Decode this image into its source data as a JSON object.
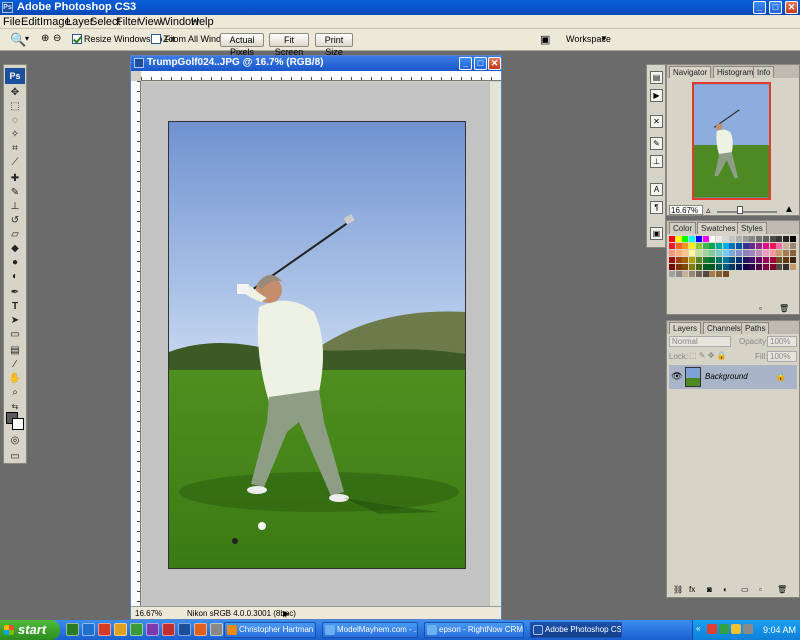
{
  "app": {
    "title": "Adobe Photoshop CS3"
  },
  "menu": [
    "File",
    "Edit",
    "Image",
    "Layer",
    "Select",
    "Filter",
    "View",
    "Window",
    "Help"
  ],
  "options": {
    "resize_windows": "Resize Windows To Fit",
    "zoom_all": "Zoom All Windows",
    "actual_pixels": "Actual Pixels",
    "fit_screen": "Fit Screen",
    "print_size": "Print Size",
    "workspace": "Workspace"
  },
  "document": {
    "title": "TrumpGolf024..JPG @ 16.7% (RGB/8)",
    "zoom": "16.67%",
    "profile": "Nikon sRGB 4.0.0.3001 (8bpc)"
  },
  "navigator": {
    "tabs": [
      "Navigator",
      "Histogram",
      "Info"
    ],
    "zoom": "16.67%"
  },
  "swatches": {
    "tabs": [
      "Color",
      "Swatches",
      "Styles"
    ],
    "colors": [
      "#ff0000",
      "#ffff00",
      "#00ff00",
      "#00ffff",
      "#0000ff",
      "#ff00ff",
      "#ffffff",
      "#ebebeb",
      "#d7d7d7",
      "#c3c3c3",
      "#afafaf",
      "#9b9b9b",
      "#878787",
      "#737373",
      "#5f5f5f",
      "#4b4b4b",
      "#373737",
      "#232323",
      "#000000",
      "#ed1c24",
      "#f26522",
      "#f7941d",
      "#fff200",
      "#8dc63f",
      "#39b54a",
      "#00a651",
      "#00a99d",
      "#00aeef",
      "#0072bc",
      "#0054a6",
      "#2e3192",
      "#662d91",
      "#92278f",
      "#ec008c",
      "#ed145b",
      "#f06eaa",
      "#c7b299",
      "#998675",
      "#f7977a",
      "#f9ad81",
      "#fdc68a",
      "#fff79a",
      "#c4df9b",
      "#a3d39c",
      "#82ca9d",
      "#7accc8",
      "#6dcff6",
      "#7da7d9",
      "#8393ca",
      "#8781bd",
      "#a186be",
      "#bd8cbf",
      "#f49ac2",
      "#f6989d",
      "#c69c6d",
      "#a67c52",
      "#8c6239",
      "#9e0b0f",
      "#a0410d",
      "#a36209",
      "#aba000",
      "#598527",
      "#1a7b30",
      "#007236",
      "#00746b",
      "#0076a3",
      "#004b80",
      "#003471",
      "#1b1464",
      "#440e62",
      "#630460",
      "#9e005d",
      "#9e0039",
      "#754c24",
      "#603813",
      "#42210b",
      "#790000",
      "#7b2e00",
      "#7d4900",
      "#827b00",
      "#406618",
      "#005e20",
      "#005826",
      "#005952",
      "#005b7f",
      "#003663",
      "#002157",
      "#0d004c",
      "#32004b",
      "#4b0049",
      "#7b0046",
      "#7a0026",
      "#534741",
      "#362f2d",
      "#c69c6d",
      "#a0a0a0",
      "#8c8c8c",
      "#c7b299",
      "#998675",
      "#736357",
      "#534741",
      "#a67c52",
      "#8c6239",
      "#754c24"
    ]
  },
  "layers": {
    "tabs": [
      "Layers",
      "Channels",
      "Paths"
    ],
    "blend": "Normal",
    "opacity_label": "Opacity:",
    "opacity": "100%",
    "lock_label": "Lock:",
    "fill_label": "Fill:",
    "fill": "100%",
    "background_name": "Background"
  },
  "taskbar": {
    "start": "start",
    "tasks": [
      "Christopher Hartman ...",
      "ModelMayhem.com - ...",
      "epson - RightNow CRM",
      "Adobe Photoshop CS3"
    ],
    "clock": "9:04 AM"
  },
  "colors": {
    "titlebar": "#0548b8",
    "accent_red": "#e23b2e",
    "grass": "#4d8a23",
    "sky": "#8cadde"
  }
}
